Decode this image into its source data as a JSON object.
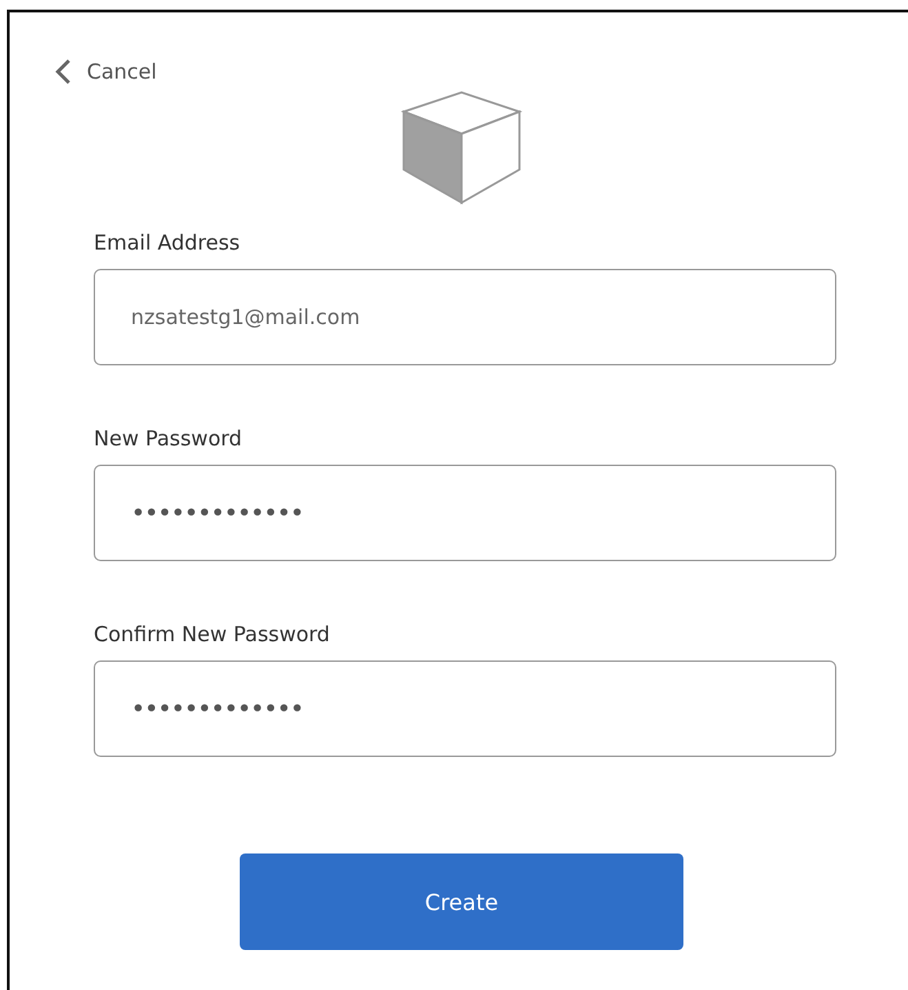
{
  "back_link": {
    "label": "Cancel"
  },
  "fields": [
    {
      "label": "Email Address",
      "value": "nzsatestg1@mail.com",
      "kind": "text"
    },
    {
      "label": "New Password",
      "value": "•••••••••••••",
      "kind": "password"
    },
    {
      "label": "Confirm New Password",
      "value": "•••••••••••••",
      "kind": "password"
    }
  ],
  "buttons": [
    {
      "label": "Create"
    }
  ]
}
